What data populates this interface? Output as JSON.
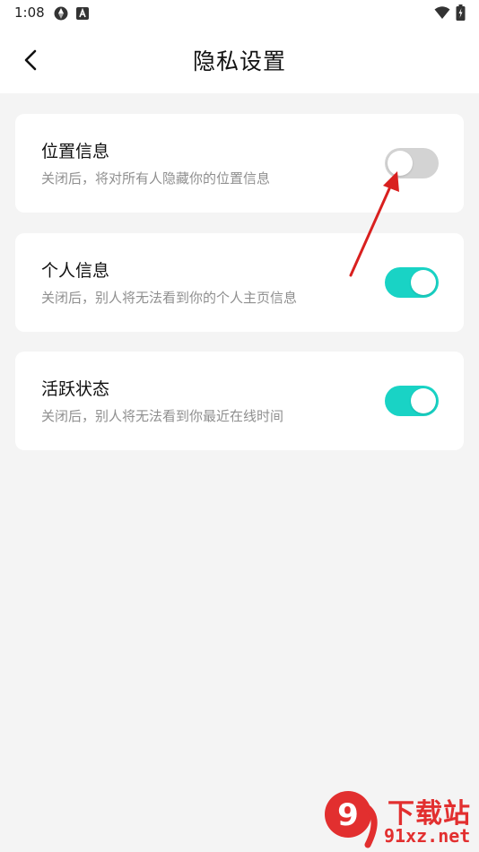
{
  "status_bar": {
    "time": "1:08",
    "left_icons": [
      "sync-icon",
      "app-notification-icon"
    ],
    "right_icons": [
      "wifi-icon",
      "battery-icon"
    ]
  },
  "header": {
    "back_icon": "chevron-left-icon",
    "title": "隐私设置"
  },
  "settings": [
    {
      "title": "位置信息",
      "description": "关闭后，将对所有人隐藏你的位置信息",
      "enabled": false
    },
    {
      "title": "个人信息",
      "description": "关闭后，别人将无法看到你的个人主页信息",
      "enabled": true
    },
    {
      "title": "活跃状态",
      "description": "关闭后，别人将无法看到你最近在线时间",
      "enabled": true
    }
  ],
  "colors": {
    "background": "#f4f4f4",
    "card": "#ffffff",
    "toggle_on": "#19d3c5",
    "toggle_off": "#d3d3d3",
    "annotation_arrow": "#d9201f",
    "watermark": "#e22f2f"
  },
  "watermark": {
    "logo_text": "9",
    "text_top": "下载站",
    "text_bottom": "91xz.net"
  }
}
